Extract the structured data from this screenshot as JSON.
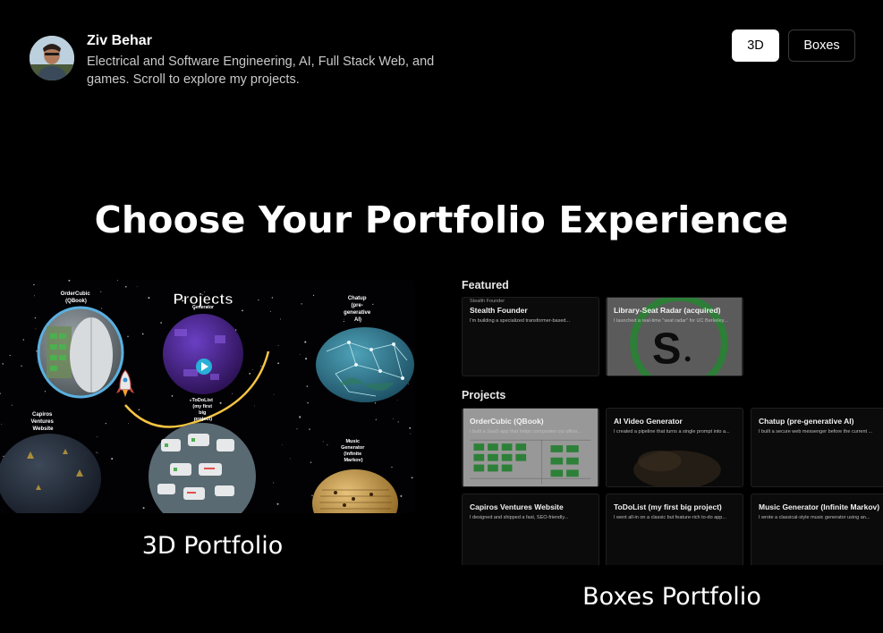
{
  "header": {
    "name": "Ziv Behar",
    "tagline": "Electrical and Software Engineering, AI, Full Stack Web, and games. Scroll to explore my projects."
  },
  "mode_buttons": {
    "three_d": "3D",
    "boxes": "Boxes"
  },
  "main_title": "Choose Your Portfolio Experience",
  "preview_3d": {
    "label": "3D Portfolio",
    "scene_title": "Projects",
    "planets": {
      "ordercubic": [
        "OrderCubic",
        "(QBook)"
      ],
      "video_gen": [
        "Generator"
      ],
      "chatup": [
        "Chatup",
        "(pre-",
        "generative",
        "AI)"
      ],
      "todolist": [
        "ToDoList",
        "(my first",
        "big",
        "project)"
      ],
      "capiros": [
        "Capiros",
        "Ventures",
        "Website"
      ],
      "music": [
        "Music",
        "Generator",
        "(Infinite",
        "Markov)"
      ]
    }
  },
  "preview_boxes": {
    "label": "Boxes Portfolio",
    "featured_heading": "Featured",
    "projects_heading": "Projects",
    "broken_image_alt": "Stealth Founder",
    "featured": [
      {
        "title": "Stealth Founder",
        "desc": "I'm building a specialized transformer-based..."
      },
      {
        "title": "Library-Seat Radar (acquired)",
        "desc": "I launched a real-time \"seat radar\" for UC Berkeley..."
      }
    ],
    "projects": [
      {
        "title": "OrderCubic (QBook)",
        "desc": "I built a SaaS app that helps companies cut office..."
      },
      {
        "title": "AI Video Generator",
        "desc": "I created a pipeline that turns a single prompt into a..."
      },
      {
        "title": "Chatup (pre-generative AI)",
        "desc": "I built a secure web messenger before the current ..."
      },
      {
        "title": "Capiros Ventures Website",
        "desc": "I designed and shipped a fast, SEO-friendly..."
      },
      {
        "title": "ToDoList (my first big project)",
        "desc": "I went all-in on a classic but feature-rich to-do app..."
      },
      {
        "title": "Music Generator (Infinite Markov)",
        "desc": "I wrote a classical-style music generator using an..."
      }
    ]
  },
  "colors": {
    "background": "#000000",
    "accent_white": "#ffffff",
    "rocket_trail": "#f5c542"
  }
}
